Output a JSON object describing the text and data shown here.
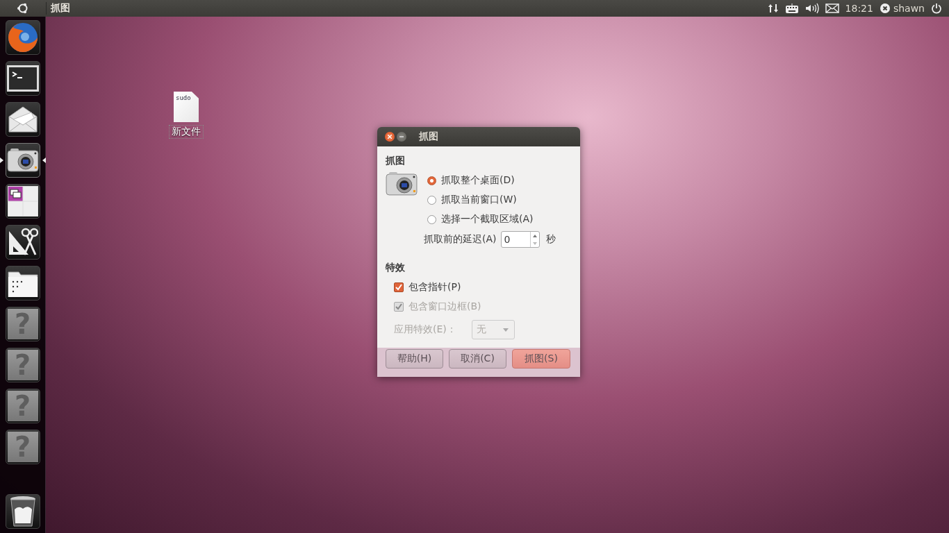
{
  "top_panel": {
    "app_title": "抓图",
    "clock": "18:21",
    "user": "shawn"
  },
  "launcher": {
    "items": [
      {
        "kind": "firefox",
        "running": false
      },
      {
        "kind": "terminal",
        "running": false
      },
      {
        "kind": "mail",
        "running": false
      },
      {
        "kind": "camera",
        "running": true
      },
      {
        "kind": "workspaces",
        "running": false
      },
      {
        "kind": "accessories",
        "running": false
      },
      {
        "kind": "folder",
        "running": false
      },
      {
        "kind": "unknown",
        "running": false,
        "glyph": "?"
      },
      {
        "kind": "unknown",
        "running": false,
        "glyph": "?"
      },
      {
        "kind": "unknown",
        "running": false,
        "glyph": "?"
      },
      {
        "kind": "unknown",
        "running": false,
        "glyph": "?"
      }
    ],
    "trash": {
      "kind": "trash"
    }
  },
  "desktop_icons": [
    {
      "label": "新文件",
      "preview_text": "sudo"
    }
  ],
  "dialog": {
    "title": "抓图",
    "capture_heading": "抓图",
    "options": [
      {
        "label": "抓取整个桌面(D)",
        "selected": true
      },
      {
        "label": "抓取当前窗口(W)",
        "selected": false
      },
      {
        "label": "选择一个截取区域(A)",
        "selected": false
      }
    ],
    "delay": {
      "label": "抓取前的延迟(A)",
      "value": "0",
      "unit": "秒"
    },
    "effects_heading": "特效",
    "checks": [
      {
        "label": "包含指针(P)",
        "checked": true,
        "disabled": false
      },
      {
        "label": "包含窗口边框(B)",
        "checked": true,
        "disabled": true
      }
    ],
    "effect": {
      "label": "应用特效(E)：",
      "value": "无",
      "disabled": true
    },
    "buttons": [
      {
        "label": "帮助(H)",
        "kind": "normal"
      },
      {
        "label": "取消(C)",
        "kind": "normal"
      },
      {
        "label": "抓图(S)",
        "kind": "default"
      }
    ]
  }
}
